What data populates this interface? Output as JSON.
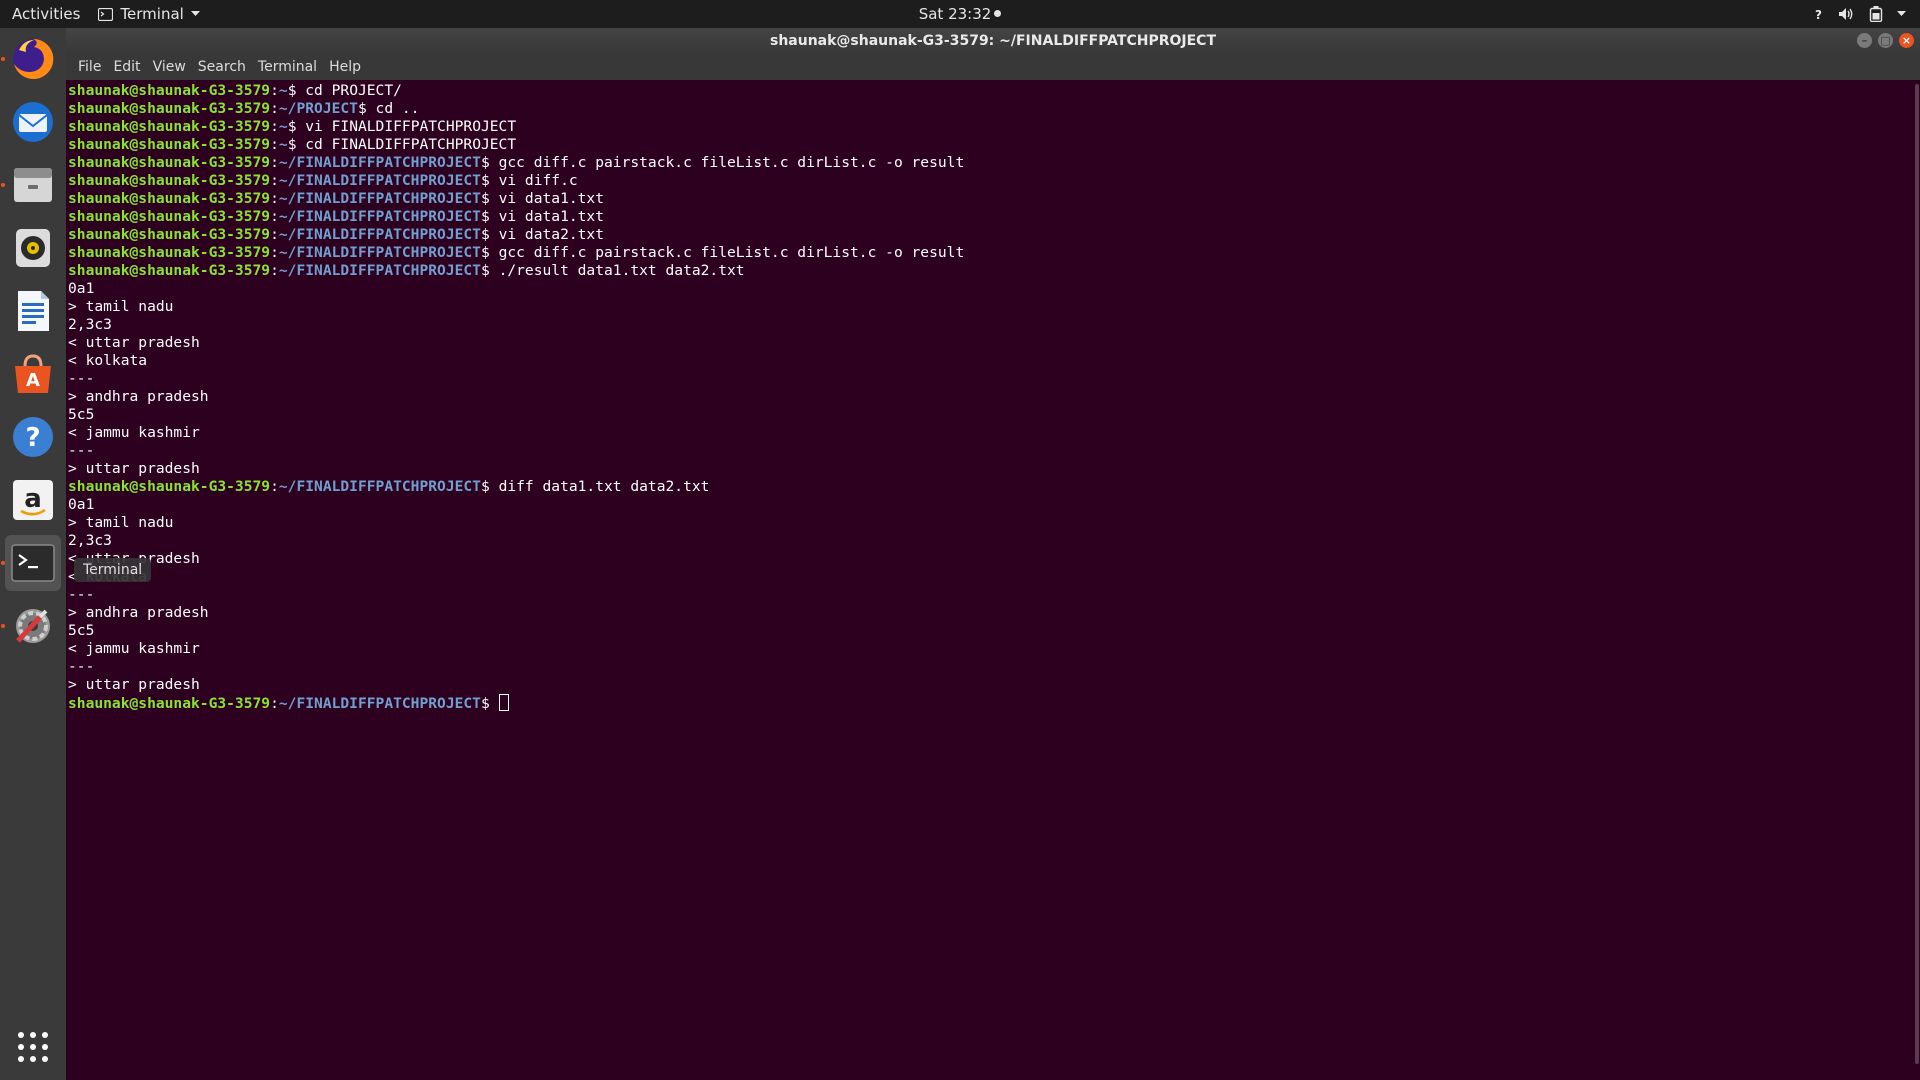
{
  "topbar": {
    "activities": "Activities",
    "app_menu": "Terminal",
    "clock": "Sat 23:32",
    "tray_icons": [
      "help-icon",
      "volume-icon",
      "battery-icon",
      "chevron-down-icon"
    ]
  },
  "dock": {
    "items": [
      {
        "name": "firefox",
        "icon": "firefox-icon",
        "running": true
      },
      {
        "name": "thunderbird",
        "icon": "mail-icon",
        "running": false
      },
      {
        "name": "files",
        "icon": "files-icon",
        "running": true
      },
      {
        "name": "rhythmbox",
        "icon": "music-icon",
        "running": false
      },
      {
        "name": "libreoffice-writer",
        "icon": "writer-icon",
        "running": false
      },
      {
        "name": "software",
        "icon": "software-center-icon",
        "running": false
      },
      {
        "name": "help",
        "icon": "help-icon",
        "running": false
      },
      {
        "name": "amazon",
        "icon": "amazon-icon",
        "running": false
      },
      {
        "name": "terminal",
        "icon": "terminal-icon",
        "running": true
      },
      {
        "name": "settings",
        "icon": "settings-icon",
        "running": true
      }
    ],
    "show_apps_icon": "grid-icon",
    "tooltip": "Terminal"
  },
  "window": {
    "title": "shaunak@shaunak-G3-3579: ~/FINALDIFFPATCHPROJECT",
    "menu": [
      "File",
      "Edit",
      "View",
      "Search",
      "Terminal",
      "Help"
    ]
  },
  "terminal": {
    "colors": {
      "user": "#8ae234",
      "path": "#729fcf",
      "text": "#ffffff",
      "background": "#2c001e"
    },
    "lines": [
      {
        "user": "shaunak@shaunak-G3-3579",
        "path": "~",
        "cmd": "cd PROJECT/"
      },
      {
        "user": "shaunak@shaunak-G3-3579",
        "path": "~/PROJECT",
        "cmd": "cd .."
      },
      {
        "user": "shaunak@shaunak-G3-3579",
        "path": "~",
        "cmd": "vi FINALDIFFPATCHPROJECT"
      },
      {
        "user": "shaunak@shaunak-G3-3579",
        "path": "~",
        "cmd": "cd FINALDIFFPATCHPROJECT"
      },
      {
        "user": "shaunak@shaunak-G3-3579",
        "path": "~/FINALDIFFPATCHPROJECT",
        "cmd": "gcc diff.c pairstack.c fileList.c dirList.c -o result"
      },
      {
        "user": "shaunak@shaunak-G3-3579",
        "path": "~/FINALDIFFPATCHPROJECT",
        "cmd": "vi diff.c"
      },
      {
        "user": "shaunak@shaunak-G3-3579",
        "path": "~/FINALDIFFPATCHPROJECT",
        "cmd": "vi data1.txt"
      },
      {
        "user": "shaunak@shaunak-G3-3579",
        "path": "~/FINALDIFFPATCHPROJECT",
        "cmd": "vi data1.txt"
      },
      {
        "user": "shaunak@shaunak-G3-3579",
        "path": "~/FINALDIFFPATCHPROJECT",
        "cmd": "vi data2.txt"
      },
      {
        "user": "shaunak@shaunak-G3-3579",
        "path": "~/FINALDIFFPATCHPROJECT",
        "cmd": "gcc diff.c pairstack.c fileList.c dirList.c -o result"
      },
      {
        "user": "shaunak@shaunak-G3-3579",
        "path": "~/FINALDIFFPATCHPROJECT",
        "cmd": "./result data1.txt data2.txt"
      },
      {
        "text": "0a1"
      },
      {
        "text": "> tamil nadu"
      },
      {
        "text": "2,3c3"
      },
      {
        "text": "< uttar pradesh"
      },
      {
        "text": "< kolkata"
      },
      {
        "text": "---"
      },
      {
        "text": "> andhra pradesh"
      },
      {
        "text": "5c5"
      },
      {
        "text": "< jammu kashmir"
      },
      {
        "text": "---"
      },
      {
        "text": "> uttar pradesh"
      },
      {
        "user": "shaunak@shaunak-G3-3579",
        "path": "~/FINALDIFFPATCHPROJECT",
        "cmd": "diff data1.txt data2.txt"
      },
      {
        "text": "0a1"
      },
      {
        "text": "> tamil nadu"
      },
      {
        "text": "2,3c3"
      },
      {
        "text": "< uttar pradesh"
      },
      {
        "text": "< kolkata"
      },
      {
        "text": "---"
      },
      {
        "text": "> andhra pradesh"
      },
      {
        "text": "5c5"
      },
      {
        "text": "< jammu kashmir"
      },
      {
        "text": "---"
      },
      {
        "text": "> uttar pradesh"
      },
      {
        "user": "shaunak@shaunak-G3-3579",
        "path": "~/FINALDIFFPATCHPROJECT",
        "cmd": "",
        "cursor": true
      }
    ]
  }
}
